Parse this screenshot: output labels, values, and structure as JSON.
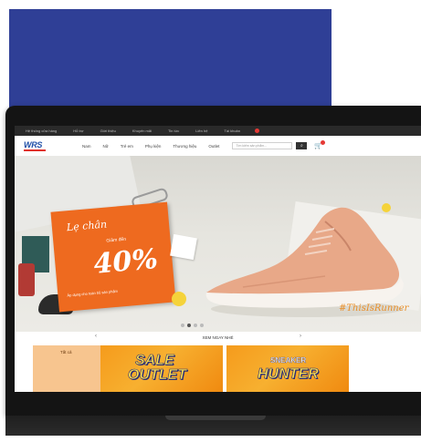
{
  "topbar": {
    "items": [
      "Hệ thống cửa hàng",
      "Hỗ trợ",
      "Giới thiệu",
      "Khuyến mãi",
      "Tin tức",
      "Liên hệ",
      "Tài khoản"
    ]
  },
  "header": {
    "logo": "WRS",
    "menu": [
      "Nam",
      "Nữ",
      "Trẻ em",
      "Phụ kiện",
      "Thương hiệu",
      "Outlet"
    ],
    "search_placeholder": "Tìm kiếm sản phẩm...",
    "search_icon": "search-icon",
    "cart_icon": "cart-icon"
  },
  "hero": {
    "script_text": "Lẹ chân",
    "small_text": "Giảm đến",
    "percent": "40%",
    "note": "Áp dụng cho toàn bộ sản phẩm",
    "tag": "#ThisIsRunner",
    "slides_total": 4,
    "slide_active": 1
  },
  "section": {
    "title": "XEM NGAY NHÉ",
    "left_label": "Tất cả"
  },
  "tiles": {
    "sale_title": "SALE",
    "sale_sub": "OUTLET",
    "hunter_title": "SNEAKER",
    "hunter_sub": "HUNTER"
  },
  "colors": {
    "banner_blue": "#2f3f96",
    "accent_orange": "#ee6a1f",
    "tile_yellow": "#f7b030"
  }
}
